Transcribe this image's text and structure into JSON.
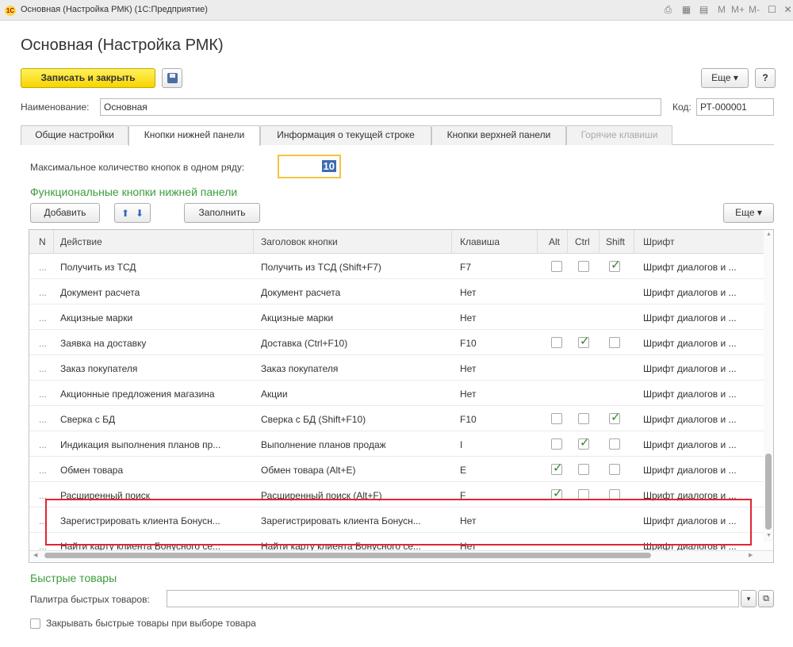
{
  "window": {
    "title": "Основная (Настройка РМК) (1С:Предприятие)",
    "logo": "1С"
  },
  "page_title": "Основная (Настройка РМК)",
  "toolbar": {
    "save_close": "Записать и закрыть",
    "more": "Еще ▾",
    "help": "?"
  },
  "name_label": "Наименование:",
  "name_value": "Основная",
  "code_label": "Код:",
  "code_value": "РТ-000001",
  "tabs": [
    "Общие настройки",
    "Кнопки нижней панели",
    "Информация о текущей строке",
    "Кнопки верхней панели",
    "Горячие клавиши"
  ],
  "max_label": "Максимальное количество кнопок в одном ряду:",
  "max_value": "10",
  "section_buttons": "Функциональные кнопки нижней панели",
  "grid_toolbar": {
    "add": "Добавить",
    "fill": "Заполнить",
    "more": "Еще ▾"
  },
  "columns": [
    "N",
    "Действие",
    "Заголовок кнопки",
    "Клавиша",
    "Alt",
    "Ctrl",
    "Shift",
    "Шрифт"
  ],
  "rows": [
    {
      "n": "...",
      "action": "Получить из ТСД",
      "caption": "Получить из ТСД (Shift+F7)",
      "key": "F7",
      "alt": false,
      "ctrl": false,
      "shift": true,
      "font": "Шрифт диалогов и ..."
    },
    {
      "n": "...",
      "action": "Документ расчета",
      "caption": "Документ расчета",
      "key": "Нет",
      "alt": null,
      "ctrl": null,
      "shift": null,
      "font": "Шрифт диалогов и ..."
    },
    {
      "n": "...",
      "action": "Акцизные марки",
      "caption": "Акцизные марки",
      "key": "Нет",
      "alt": null,
      "ctrl": null,
      "shift": null,
      "font": "Шрифт диалогов и ..."
    },
    {
      "n": "...",
      "action": "Заявка на доставку",
      "caption": "Доставка (Ctrl+F10)",
      "key": "F10",
      "alt": false,
      "ctrl": true,
      "shift": false,
      "font": "Шрифт диалогов и ..."
    },
    {
      "n": "...",
      "action": "Заказ покупателя",
      "caption": "Заказ покупателя",
      "key": "Нет",
      "alt": null,
      "ctrl": null,
      "shift": null,
      "font": "Шрифт диалогов и ..."
    },
    {
      "n": "...",
      "action": "Акционные предложения магазина",
      "caption": "Акции",
      "key": "Нет",
      "alt": null,
      "ctrl": null,
      "shift": null,
      "font": "Шрифт диалогов и ..."
    },
    {
      "n": "...",
      "action": "Сверка с БД",
      "caption": "Сверка с БД (Shift+F10)",
      "key": "F10",
      "alt": false,
      "ctrl": false,
      "shift": true,
      "font": "Шрифт диалогов и ..."
    },
    {
      "n": "...",
      "action": "Индикация выполнения планов пр...",
      "caption": "Выполнение планов продаж",
      "key": "I",
      "alt": false,
      "ctrl": true,
      "shift": false,
      "font": "Шрифт диалогов и ..."
    },
    {
      "n": "...",
      "action": "Обмен товара",
      "caption": "Обмен товара (Alt+E)",
      "key": "E",
      "alt": true,
      "ctrl": false,
      "shift": false,
      "font": "Шрифт диалогов и ..."
    },
    {
      "n": "...",
      "action": "Расширенный поиск",
      "caption": "Расширенный поиск (Alt+F)",
      "key": "F",
      "alt": true,
      "ctrl": false,
      "shift": false,
      "font": "Шрифт диалогов и ..."
    },
    {
      "n": "...",
      "action": "Зарегистрировать клиента Бонусн...",
      "caption": "Зарегистрировать клиента Бонусн...",
      "key": "Нет",
      "alt": null,
      "ctrl": null,
      "shift": null,
      "font": "Шрифт диалогов и ..."
    },
    {
      "n": "...",
      "action": "Найти карту клиента Бонусного се...",
      "caption": "Найти карту клиента Бонусного се...",
      "key": "Нет",
      "alt": null,
      "ctrl": null,
      "shift": null,
      "font": "Шрифт диалогов и ..."
    }
  ],
  "section_quick": "Быстрые товары",
  "palette_label": "Палитра быстрых товаров:",
  "palette_value": "",
  "close_quick_label": "Закрывать быстрые товары при выборе товара",
  "colors": {
    "accent_yellow": "#f7d400",
    "section_green": "#3d9c3d",
    "highlight_red": "#e0252f",
    "check_green": "#2b8a2b"
  }
}
